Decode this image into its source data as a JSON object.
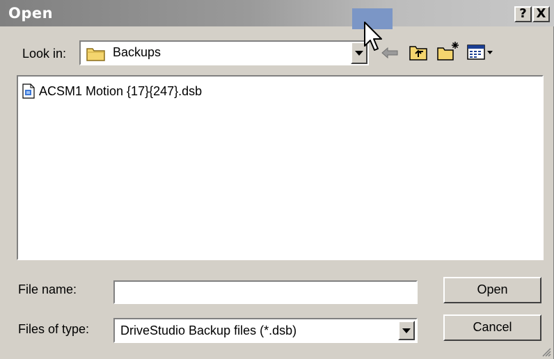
{
  "window": {
    "title": "Open",
    "help_label": "?",
    "close_label": "X"
  },
  "toolbar": {
    "look_in_label": "Look in:",
    "look_in_value": "Backups",
    "icons": [
      "back-icon",
      "up-folder-icon",
      "new-folder-icon",
      "view-menu-icon"
    ]
  },
  "files": [
    {
      "name": "ACSM1 Motion {17}{247}.dsb",
      "icon": "dsb-file-icon"
    }
  ],
  "form": {
    "file_name_label": "File name:",
    "file_name_value": "",
    "file_type_label": "Files of type:",
    "file_type_value": "DriveStudio Backup files (*.dsb)"
  },
  "buttons": {
    "open": "Open",
    "cancel": "Cancel"
  },
  "colors": {
    "dialog_bg": "#d4d0c8",
    "title_inactive": "#808080",
    "highlight": "#7b96c6"
  }
}
